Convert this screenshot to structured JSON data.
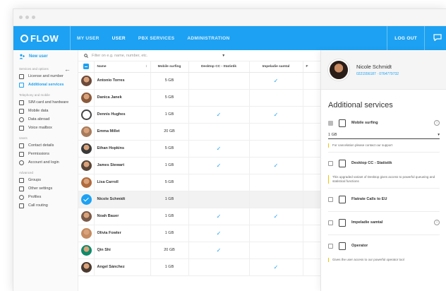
{
  "topbar": {
    "logo": "FLOW",
    "nav": [
      "MY USER",
      "USER",
      "PBX SERVICES",
      "ADMINISTRATION"
    ],
    "active_nav": "USER",
    "logout": "LOG OUT"
  },
  "sidebar": {
    "new_user": "New user",
    "sections": [
      {
        "title": "Services and options",
        "items": [
          {
            "label": "License and number",
            "icon": "license-icon"
          },
          {
            "label": "Additional services",
            "icon": "services-icon",
            "active": true
          }
        ]
      },
      {
        "title": "Telephony and mobile",
        "items": [
          {
            "label": "SIM card and hardware",
            "icon": "sim-icon"
          },
          {
            "label": "Mobile data",
            "icon": "data-icon"
          },
          {
            "label": "Data abroad",
            "icon": "abroad-icon"
          },
          {
            "label": "Voice mailbox",
            "icon": "voicemail-icon"
          }
        ]
      },
      {
        "title": "Users",
        "items": [
          {
            "label": "Contact details",
            "icon": "contact-icon"
          },
          {
            "label": "Permissions",
            "icon": "permissions-icon"
          },
          {
            "label": "Account and login",
            "icon": "account-icon"
          }
        ]
      },
      {
        "title": "Advanced",
        "items": [
          {
            "label": "Groups",
            "icon": "groups-icon"
          },
          {
            "label": "Other settings",
            "icon": "settings-icon"
          },
          {
            "label": "Profiles",
            "icon": "profiles-icon"
          },
          {
            "label": "Call routing",
            "icon": "routing-icon"
          }
        ]
      }
    ]
  },
  "filter": {
    "placeholder": "Filter on e.g. name, number, etc."
  },
  "table": {
    "columns": [
      "Name",
      "Mobile surfing",
      "Desktop CC - Statistik",
      "Impeladie samtal"
    ],
    "rows": [
      {
        "name": "Antonio Torres",
        "surf": "5 GB",
        "desk": false,
        "imp": true,
        "color": "#6b4a3a"
      },
      {
        "name": "Danica Janek",
        "surf": "5 GB",
        "desk": false,
        "imp": false,
        "color": "#8a5a3c"
      },
      {
        "name": "Dennis Hughes",
        "surf": "1 GB",
        "desk": true,
        "imp": true,
        "color": "generic"
      },
      {
        "name": "Emma Millet",
        "surf": "20 GB",
        "desk": false,
        "imp": false,
        "color": "#a67b5b"
      },
      {
        "name": "Ethan Hopkins",
        "surf": "5 GB",
        "desk": true,
        "imp": false,
        "color": "#3a3a3a"
      },
      {
        "name": "James Stewart",
        "surf": "1 GB",
        "desk": true,
        "imp": true,
        "color": "#5a4636"
      },
      {
        "name": "Lisa Carroll",
        "surf": "5 GB",
        "desk": false,
        "imp": false,
        "color": "#b06a3c"
      },
      {
        "name": "Nicole Schmidt",
        "surf": "1 GB",
        "desk": false,
        "imp": false,
        "color": "selected"
      },
      {
        "name": "Noah Bauer",
        "surf": "1 GB",
        "desk": true,
        "imp": true,
        "color": "#7a5a48"
      },
      {
        "name": "Olivia Fowler",
        "surf": "1 GB",
        "desk": true,
        "imp": false,
        "color": "#c48a60"
      },
      {
        "name": "Qin Shi",
        "surf": "20 GB",
        "desk": true,
        "imp": false,
        "color": "#0f8a6a"
      },
      {
        "name": "Angel Sánchez",
        "surf": "1 GB",
        "desk": false,
        "imp": true,
        "color": "#4a3a30"
      }
    ]
  },
  "panel": {
    "user_name": "Nicole Schmidt",
    "user_numbers": "0221556187 · 0764779732",
    "title": "Additional services",
    "services": [
      {
        "label": "Mobile surfing",
        "checked": true,
        "info": true,
        "select": "1 GB",
        "note": "For cancelation please contact our support"
      },
      {
        "label": "Desktop CC - Statistik",
        "checked": false,
        "info": false,
        "note": "This upgraded variant of Desktop gives access to powerful queueing and statistical functions"
      },
      {
        "label": "Flatrate Calls to EU",
        "checked": false,
        "info": false
      },
      {
        "label": "Impeladie samtal",
        "checked": false,
        "info": true
      },
      {
        "label": "Operator",
        "checked": false,
        "info": false,
        "note": "Gives the user access to our powerful operator tool"
      }
    ]
  },
  "colors": {
    "accent": "#1da1f2",
    "note_bar": "#f5c400"
  }
}
